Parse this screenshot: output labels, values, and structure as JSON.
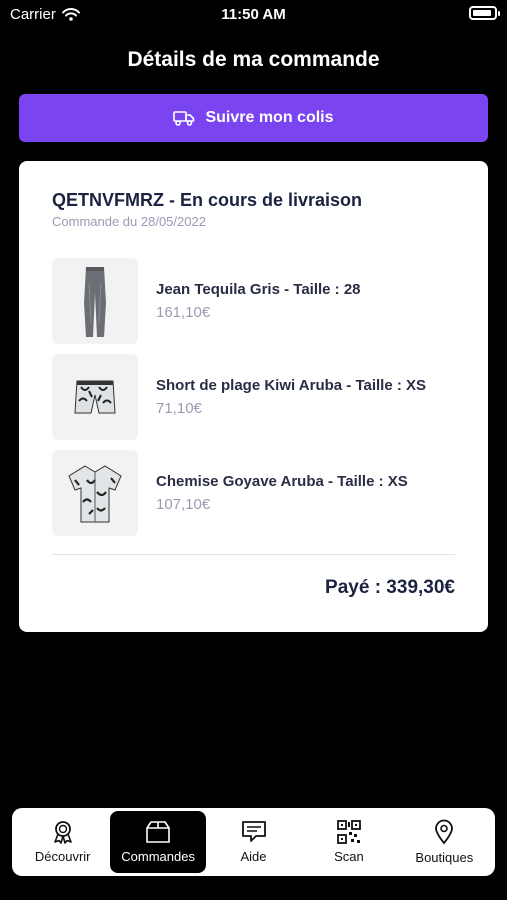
{
  "status_bar": {
    "carrier": "Carrier",
    "time": "11:50 AM",
    "battery_level": 0.9
  },
  "page_title": "Détails de ma commande",
  "track_button": {
    "label": "Suivre mon colis",
    "icon": "truck-icon"
  },
  "order": {
    "title": "QETNVFMRZ - En cours de livraison",
    "date": "Commande du 28/05/2022",
    "items": [
      {
        "name": "Jean Tequila Gris - Taille : 28",
        "price": "161,10€",
        "image": "jeans-image"
      },
      {
        "name": "Short de plage Kiwi Aruba - Taille : XS",
        "price": "71,10€",
        "image": "shorts-image"
      },
      {
        "name": "Chemise Goyave Aruba - Taille : XS",
        "price": "107,10€",
        "image": "shirt-image"
      }
    ],
    "total": "Payé : 339,30€"
  },
  "tabs": [
    {
      "label": "Découvrir",
      "icon": "award-icon",
      "active": false
    },
    {
      "label": "Commandes",
      "icon": "box-icon",
      "active": true
    },
    {
      "label": "Aide",
      "icon": "chat-icon",
      "active": false
    },
    {
      "label": "Scan",
      "icon": "qr-code-icon",
      "active": false
    },
    {
      "label": "Boutiques",
      "icon": "map-pin-icon",
      "active": false
    }
  ]
}
